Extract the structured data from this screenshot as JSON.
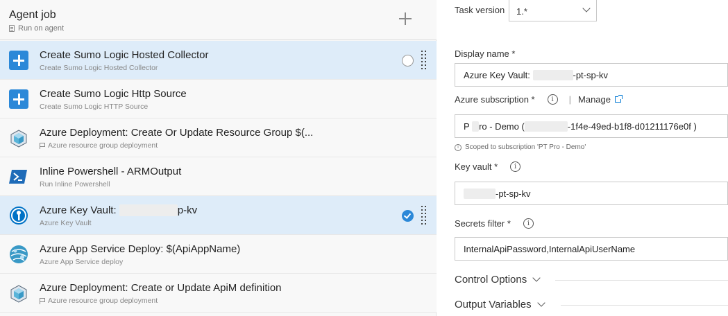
{
  "agent_job": {
    "title": "Agent job",
    "subtitle": "Run on agent"
  },
  "tasks": [
    {
      "title": "Create Sumo Logic Hosted Collector",
      "subtitle": "Create Sumo Logic Hosted Collector",
      "icon": "plus-icon"
    },
    {
      "title": "Create Sumo Logic Http Source",
      "subtitle": "Create Sumo Logic HTTP Source",
      "icon": "plus-icon"
    },
    {
      "title": "Azure Deployment: Create Or Update Resource Group $(...",
      "subtitle": "Azure resource group deployment",
      "icon": "azure-resource-group-icon"
    },
    {
      "title": "Inline Powershell - ARMOutput",
      "subtitle": "Run Inline Powershell",
      "icon": "powershell-icon"
    },
    {
      "title_prefix": "Azure Key Vault:",
      "title_suffix": "p-kv",
      "subtitle": "Azure Key Vault",
      "icon": "key-vault-icon"
    },
    {
      "title": "Azure App Service Deploy: $(ApiAppName)",
      "subtitle": "Azure App Service deploy",
      "icon": "app-service-icon"
    },
    {
      "title": "Azure Deployment: Create or Update ApiM definition",
      "subtitle": "Azure resource group deployment",
      "icon": "azure-resource-group-icon"
    }
  ],
  "form": {
    "task_version_label": "Task version",
    "task_version_value": "1.*",
    "display_name_label": "Display name *",
    "display_name_prefix": "Azure Key Vault:",
    "display_name_suffix": "-pt-sp-kv",
    "azure_subscription_label": "Azure subscription *",
    "manage_label": "Manage",
    "subscription_prefix": "P",
    "subscription_mid": "ro - Demo (",
    "subscription_suffix": "-1f4e-49ed-b1f8-d01211176e0f )",
    "scoped_note": "Scoped to subscription 'PT Pro - Demo'",
    "key_vault_label": "Key vault *",
    "key_vault_suffix": "-pt-sp-kv",
    "secrets_filter_label": "Secrets filter *",
    "secrets_filter_value": "InternalApiPassword,InternalApiUserName",
    "control_options": "Control Options",
    "output_variables": "Output Variables",
    "info_glyph": "i"
  }
}
